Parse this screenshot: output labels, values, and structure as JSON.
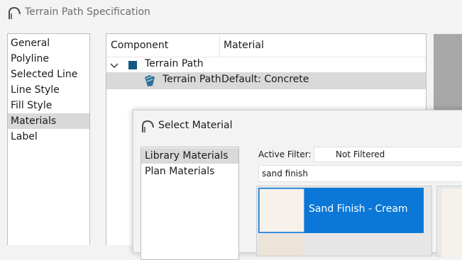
{
  "window": {
    "title": "Terrain Path Specification"
  },
  "nav": {
    "items": [
      {
        "label": "General"
      },
      {
        "label": "Polyline"
      },
      {
        "label": "Selected Line"
      },
      {
        "label": "Line Style"
      },
      {
        "label": "Fill Style"
      },
      {
        "label": "Materials",
        "selected": true
      },
      {
        "label": "Label"
      }
    ]
  },
  "tree": {
    "columns": [
      "Component",
      "Material"
    ],
    "rows": [
      {
        "component": "Terrain Path",
        "material": "",
        "expanded": true,
        "icon": "color-square-icon",
        "color": "#145a80"
      },
      {
        "component": "Terrain Path",
        "material": "Default: Concrete",
        "selected": true,
        "icon": "material-icon"
      }
    ]
  },
  "dialog": {
    "title": "Select Material",
    "library": [
      {
        "label": "Library Materials",
        "selected": true
      },
      {
        "label": "Plan Materials"
      }
    ],
    "filter_label": "Active Filter:",
    "filter_value": "Not Filtered",
    "search_value": "sand finish",
    "results": [
      {
        "label": "Sand Finish - Cream",
        "selected": true,
        "swatch_color": "#f6f1ea"
      }
    ]
  },
  "colors": {
    "selection": "#0b78d7",
    "row_highlight": "#d9d9d9"
  }
}
